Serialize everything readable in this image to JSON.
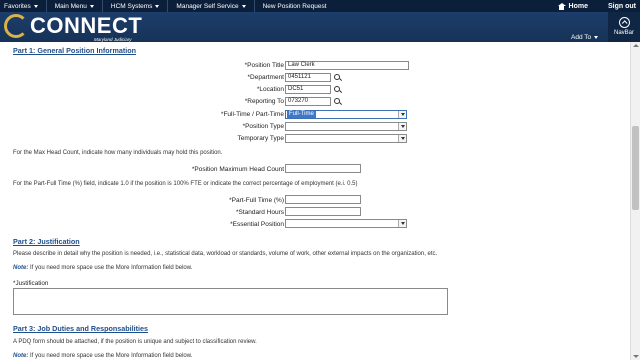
{
  "topbar": {
    "menus": [
      "Favorites",
      "Main Menu",
      "HCM Systems",
      "Manager Self Service"
    ],
    "breadcrumb_current": "New Position Request",
    "home_label": "Home",
    "signout_label": "Sign out"
  },
  "header": {
    "logo_text": "CONNECT",
    "logo_tagline": "Maryland Judiciary",
    "addto_label": "Add To",
    "navbar_label": "NavBar"
  },
  "part1": {
    "title": "Part 1: General Position Information",
    "position_title_label": "*Position Title",
    "position_title_value": "Law Clerk",
    "department_label": "*Department",
    "department_value": "0451121",
    "location_label": "*Location",
    "location_value": "DC51",
    "reporting_to_label": "*Reporting To",
    "reporting_to_value": "073270",
    "fulltime_label": "*Full-Time / Part-Time",
    "fulltime_value": "Full-Time",
    "position_type_label": "*Position Type",
    "position_type_value": "",
    "temporary_type_label": "Temporary Type",
    "temporary_type_value": "",
    "head_count_note": "For the Max Head Count, indicate how many individuals may hold this position.",
    "max_head_count_label": "*Position Maximum Head Count",
    "max_head_count_value": "",
    "fte_note": "For the Part-Full Time (%) field, indicate 1.0 if the position is 100% FTE or indicate the correct percentage of employment (e.i.  0.5)",
    "part_full_label": "*Part-Full Time (%)",
    "part_full_value": "",
    "standard_hours_label": "*Standard Hours",
    "standard_hours_value": "",
    "essential_label": "*Essential Position",
    "essential_value": ""
  },
  "part2": {
    "title": "Part 2: Justification",
    "description": "Please describe in detail why the position is needed, i.e., statistical data, workload or standards, volume of work, other external impacts on the organization, etc.",
    "note_prefix": "Note:",
    "note_text": " If you need more space use the More Information field below.",
    "justification_label": "*Justification"
  },
  "part3": {
    "title": "Part 3: Job Duties and Responsabilities",
    "description": "A PDQ form should be attached, if the position is unique and subject to classification review.",
    "note_prefix": "Note:",
    "note_text": " If you need more space use the More Information field below."
  }
}
